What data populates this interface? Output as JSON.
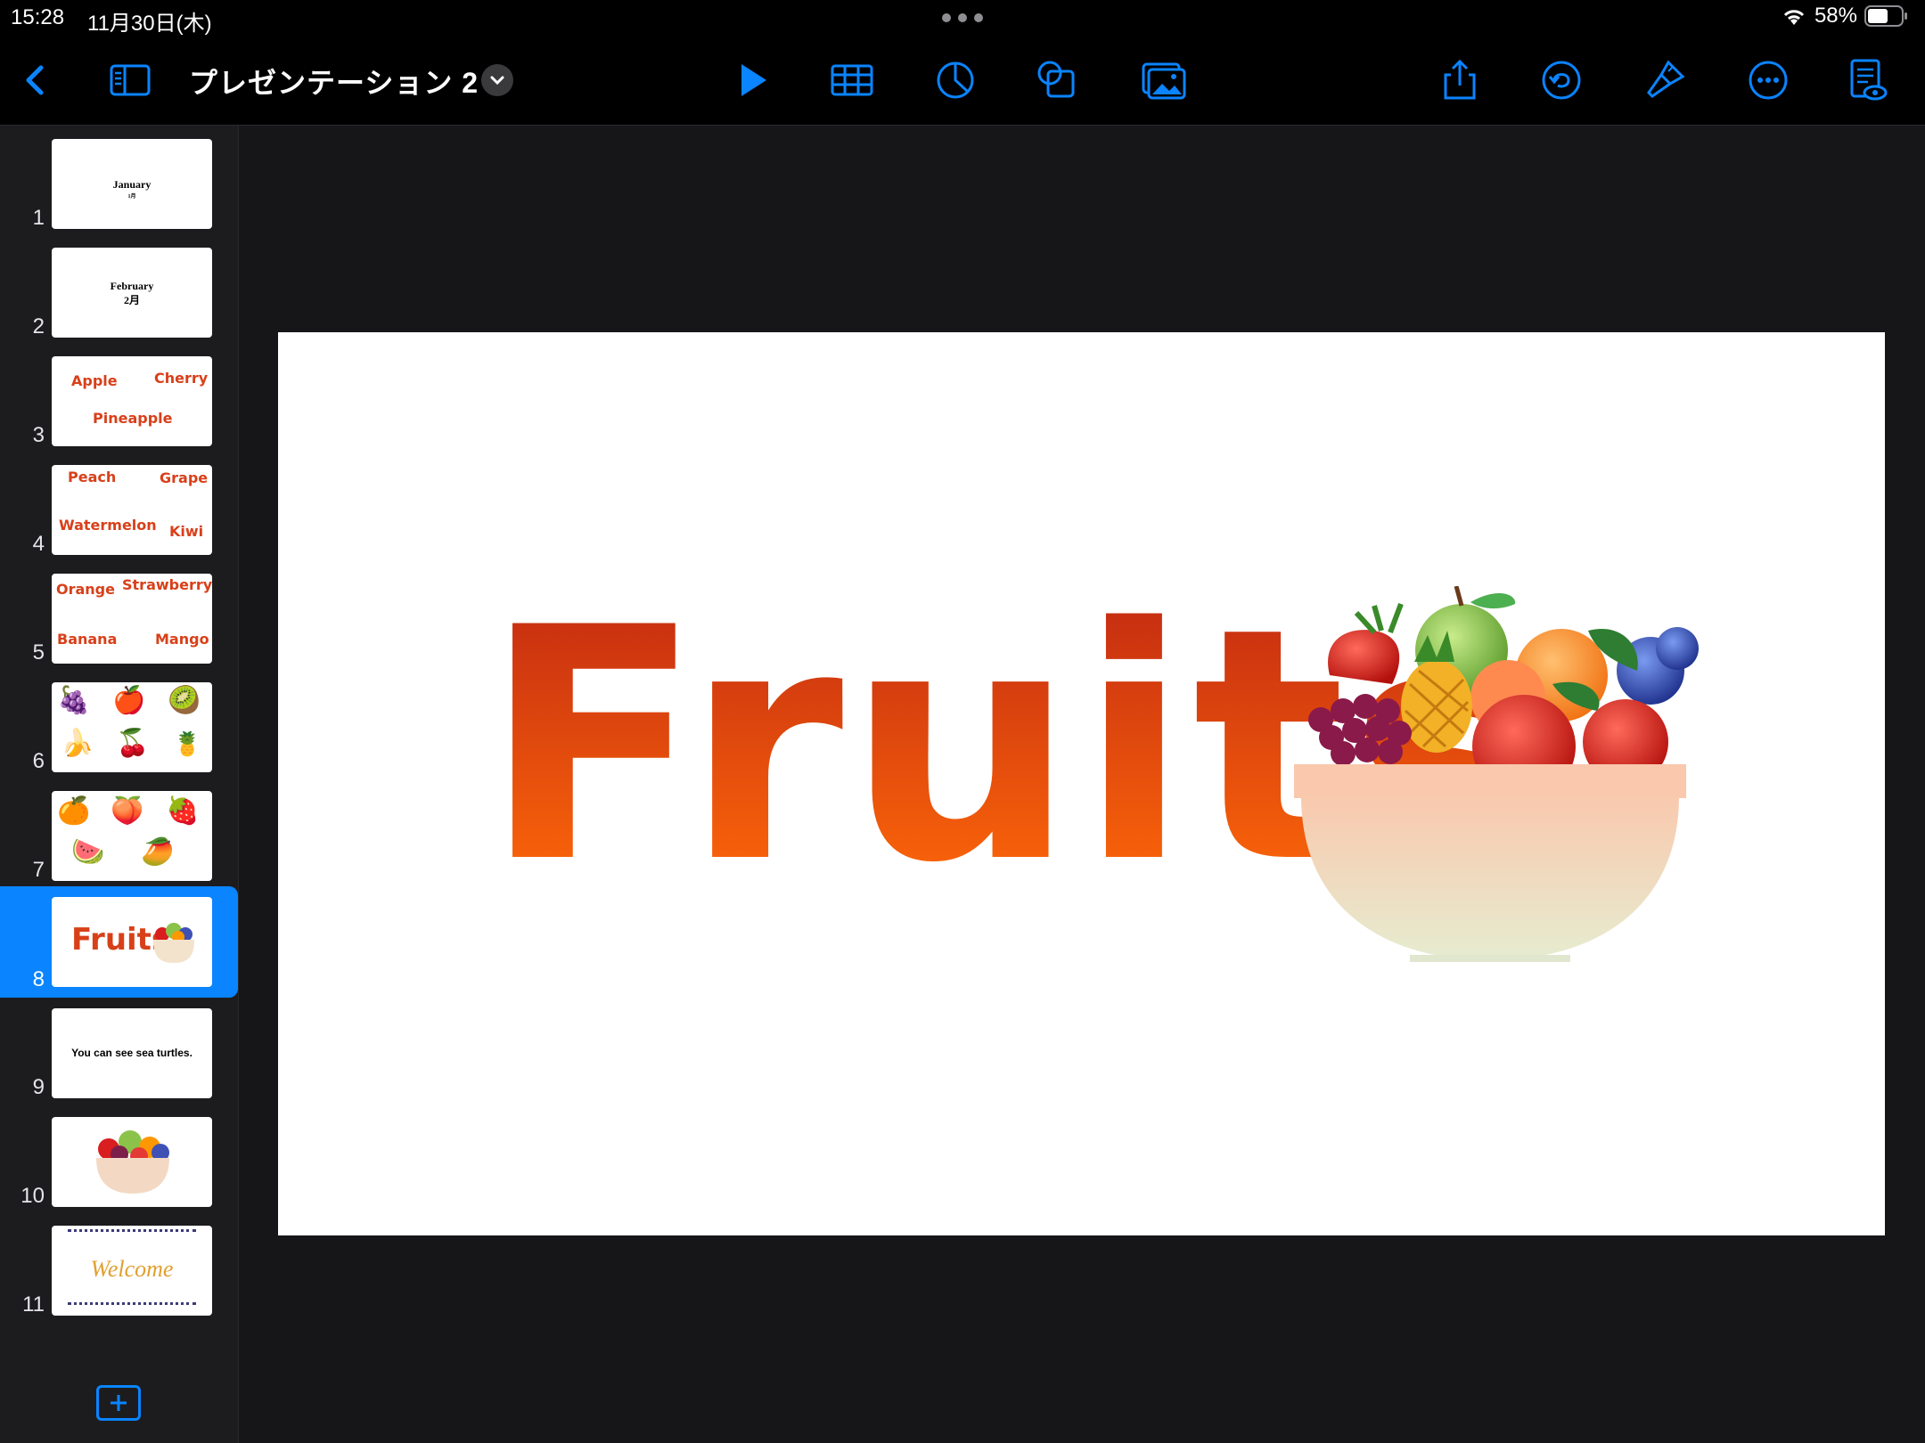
{
  "status": {
    "time": "15:28",
    "date": "11月30日(木)",
    "battery": "58%"
  },
  "toolbar": {
    "title": "プレゼンテーション 2"
  },
  "slides": [
    {
      "number": "1",
      "title": "January",
      "subtitle": "1月"
    },
    {
      "number": "2",
      "title": "February",
      "subtitle": "2月"
    },
    {
      "number": "3",
      "words": [
        "Apple",
        "Cherry",
        "Pineapple"
      ]
    },
    {
      "number": "4",
      "words": [
        "Peach",
        "Grape",
        "Watermelon",
        "Kiwi"
      ]
    },
    {
      "number": "5",
      "words": [
        "Orange",
        "Strawberry",
        "Banana",
        "Mango"
      ]
    },
    {
      "number": "6",
      "emoji": [
        "🍇",
        "🍎",
        "🥝",
        "🍌",
        "🍒",
        "🍍"
      ]
    },
    {
      "number": "7",
      "emoji": [
        "🍊",
        "🍑",
        "🍓",
        "🍉",
        "🥭"
      ]
    },
    {
      "number": "8",
      "label": "Fruits",
      "selected": true
    },
    {
      "number": "9",
      "text": "You can see sea turtles."
    },
    {
      "number": "10"
    },
    {
      "number": "11",
      "text": "Welcome"
    }
  ],
  "canvas": {
    "word": "Fruits"
  },
  "colors": {
    "accent": "#0a84ff",
    "fruit_text_top": "#c32a12",
    "fruit_text_bottom": "#ff6a08"
  }
}
